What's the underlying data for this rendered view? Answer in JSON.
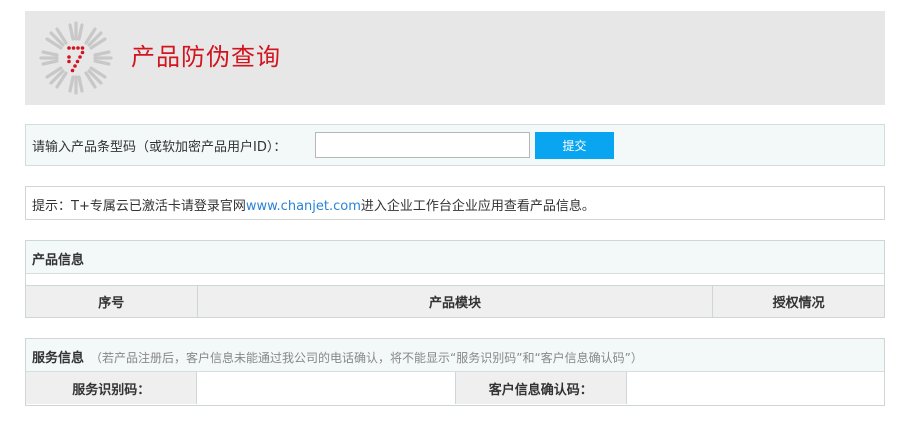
{
  "header": {
    "title": "产品防伪查询"
  },
  "query": {
    "label": "请输入产品条型码（或软加密产品用户ID）：",
    "input_value": "",
    "submit_label": "提交"
  },
  "notice": {
    "prefix": "提示：T+专属云已激活卡请登录官网",
    "link_text": "www.chanjet.com",
    "suffix": "进入企业工作台企业应用查看产品信息。"
  },
  "product_info": {
    "title": "产品信息",
    "columns": [
      "序号",
      "产品模块",
      "授权情况"
    ]
  },
  "service_info": {
    "title": "服务信息",
    "note": "（若产品注册后，客户信息未能通过我公司的电话确认，将不能显示“服务识别码”和“客户信息确认码”）",
    "service_code_label": "服务识别码：",
    "service_code_value": "",
    "customer_code_label": "客户信息确认码：",
    "customer_code_value": ""
  },
  "colors": {
    "title_red": "#d2141f",
    "button_blue": "#0aa5f0",
    "link_blue": "#2a83d6",
    "header_gray": "#e7e7e7"
  }
}
